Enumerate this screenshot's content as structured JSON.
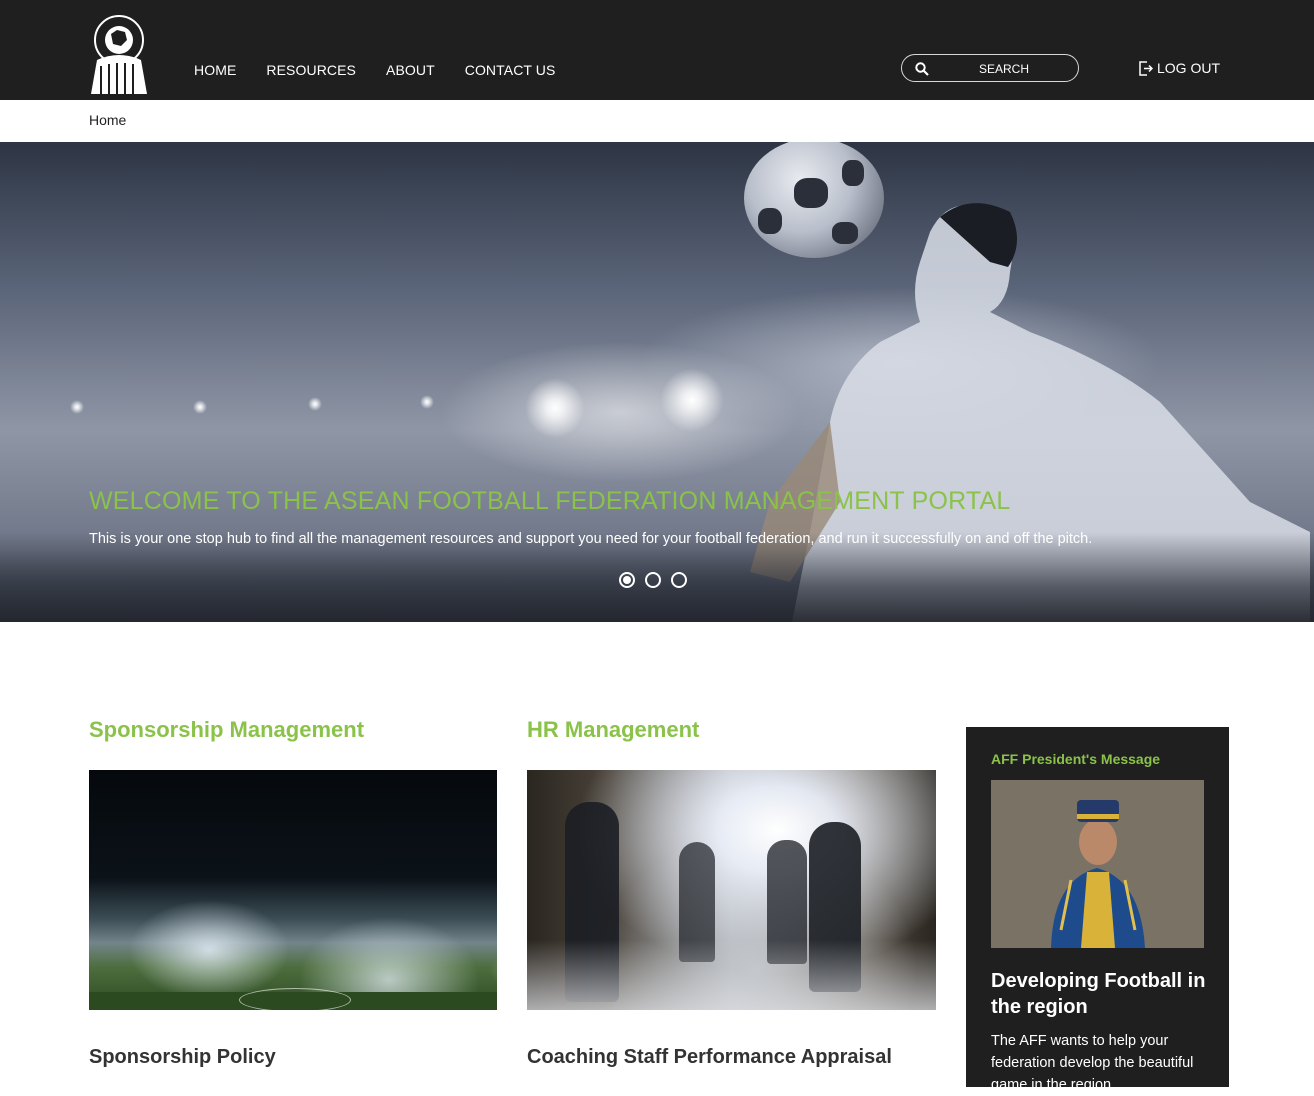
{
  "header": {
    "logo_alt": "ASEAN FOOTBALL FEDERATION",
    "nav": [
      "HOME",
      "RESOURCES",
      "ABOUT",
      "CONTACT US"
    ],
    "search_placeholder": "SEARCH",
    "logout_label": "LOG OUT",
    "icons": {
      "search": "search-icon",
      "logout": "logout-icon"
    }
  },
  "breadcrumb": "Home",
  "hero": {
    "title": "WELCOME TO THE ASEAN FOOTBALL FEDERATION MANAGEMENT PORTAL",
    "subtitle": "This is your one stop hub to find all the management resources and support you need for your football federation, and run it successfully on and off the pitch.",
    "slides": 3,
    "active_slide": 1
  },
  "cards": [
    {
      "section": "Sponsorship Management",
      "item": "Sponsorship Policy"
    },
    {
      "section": "HR Management",
      "item": "Coaching Staff Performance Appraisal"
    }
  ],
  "sidebar": {
    "title": "AFF President's Message",
    "heading": "Developing Football in the region",
    "text": "The AFF wants to help your federation develop the beautiful game in the region."
  },
  "colors": {
    "accent": "#8ac24a",
    "header_bg": "#1f1f1f",
    "sidebar_bg": "#1f1f1f"
  }
}
